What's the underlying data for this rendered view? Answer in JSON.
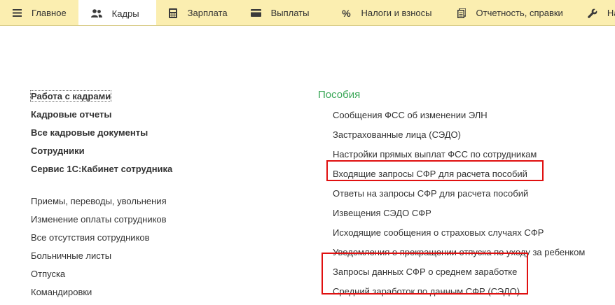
{
  "topnav": {
    "tabs": [
      {
        "label": "Главное",
        "icon": "hamburger-menu-icon"
      },
      {
        "label": "Кадры",
        "icon": "people-icon",
        "active": true
      },
      {
        "label": "Зарплата",
        "icon": "calculator-icon"
      },
      {
        "label": "Выплаты",
        "icon": "wallet-icon"
      },
      {
        "label": "Налоги и взносы",
        "icon": "percent-icon"
      },
      {
        "label": "Отчетность, справки",
        "icon": "documents-icon"
      },
      {
        "label": "Настройка",
        "icon": "wrench-icon"
      }
    ],
    "colors": {
      "bar": "#fbeeb0",
      "active": "#ffffff"
    }
  },
  "left": {
    "bold_links": [
      "Работа с кадрами",
      "Кадровые отчеты",
      "Все кадровые документы",
      "Сотрудники",
      "Сервис 1С:Кабинет сотрудника"
    ],
    "links": [
      "Приемы, переводы, увольнения",
      "Изменение оплаты сотрудников",
      "Все отсутствия сотрудников",
      "Больничные листы",
      "Отпуска",
      "Командировки"
    ]
  },
  "right": {
    "section_title": "Пособия",
    "section_title_color": "#3aa757",
    "items": [
      "Сообщения ФСС об изменении ЭЛН",
      "Застрахованные лица (СЭДО)",
      "Настройки прямых выплат ФСС по сотрудникам",
      "Входящие запросы СФР для расчета пособий",
      "Ответы на запросы СФР для расчета пособий",
      "Извещения СЭДО СФР",
      "Исходящие сообщения о страховых случаях СФР",
      "Уведомления о прекращении отпуска по уходу за ребенком",
      "Запросы данных СФР о среднем заработке",
      "Средний заработок по данным СФР (СЭДО)"
    ]
  },
  "highlight_color": "#e01010"
}
